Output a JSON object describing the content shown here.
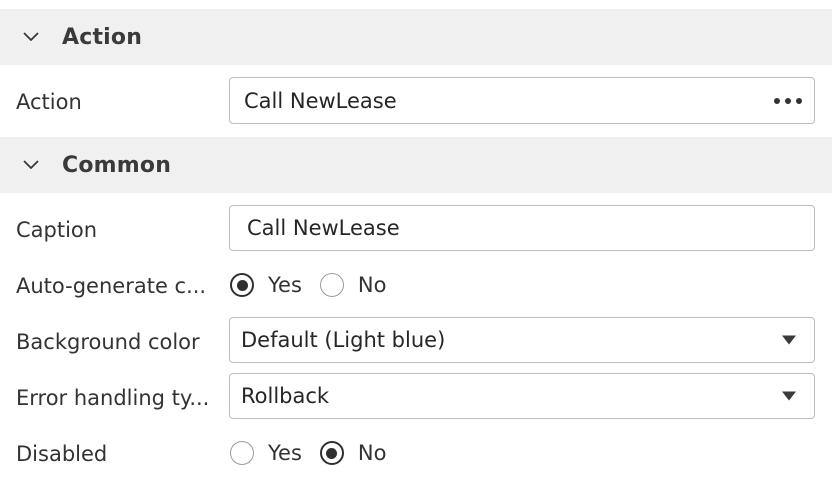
{
  "sections": {
    "action": {
      "title": "Action",
      "action_label": "Action",
      "action_value": "Call NewLease"
    },
    "common": {
      "title": "Common",
      "caption_label": "Caption",
      "caption_value": "Call NewLease",
      "autogen_label": "Auto-generate c...",
      "autogen_yes": "Yes",
      "autogen_no": "No",
      "autogen_selected": "Yes",
      "bgcolor_label": "Background color",
      "bgcolor_value": "Default (Light blue)",
      "errhandling_label": "Error handling ty...",
      "errhandling_value": "Rollback",
      "disabled_label": "Disabled",
      "disabled_yes": "Yes",
      "disabled_no": "No",
      "disabled_selected": "No"
    }
  },
  "icons": {
    "section_toggle": "chevron-down-icon",
    "picker": "more-horizontal-icon",
    "dropdown": "caret-down-icon"
  },
  "colors": {
    "header_bg": "#f0f0f0",
    "field_border": "#bdbdbd",
    "text": "#333333"
  }
}
